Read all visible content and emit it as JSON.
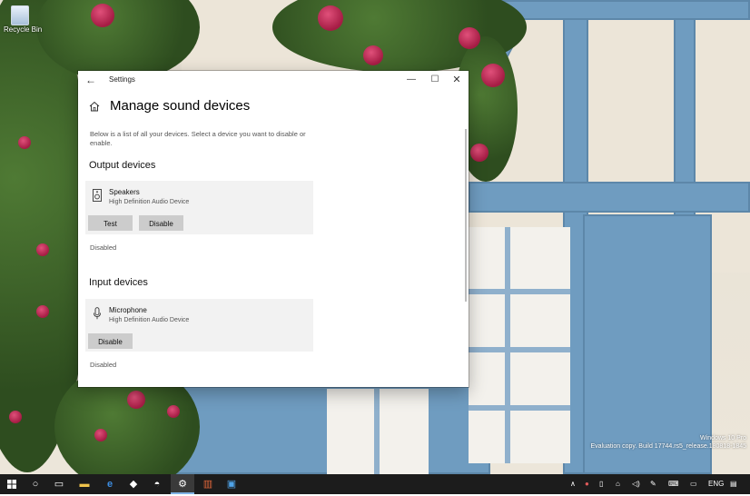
{
  "desktop": {
    "recycle_bin_label": "Recycle Bin",
    "watermark_line1": "Windows 10 Pro",
    "watermark_line2": "Evaluation copy. Build 17744.rs5_release.180818-1845"
  },
  "window": {
    "title": "Settings",
    "back_icon": "←",
    "min_icon": "—",
    "max_icon": "☐",
    "close_icon": "✕"
  },
  "page": {
    "title": "Manage sound devices",
    "intro": "Below is a list of all your devices. Select a device you want to disable or enable."
  },
  "output": {
    "section_title": "Output devices",
    "device_name": "Speakers",
    "device_sub": "High Definition Audio Device",
    "test_label": "Test",
    "disable_label": "Disable",
    "status": "Disabled"
  },
  "input": {
    "section_title": "Input devices",
    "device_name": "Microphone",
    "device_sub": "High Definition Audio Device",
    "disable_label": "Disable",
    "status": "Disabled"
  },
  "taskbar": {
    "items": [
      "start-icon",
      "search-icon",
      "task-view-icon",
      "file-explorer-icon",
      "edge-icon",
      "store-shield-icon",
      "photos-icon",
      "settings-icon",
      "app-icon",
      "store-icon"
    ],
    "tray_language": "ENG"
  }
}
